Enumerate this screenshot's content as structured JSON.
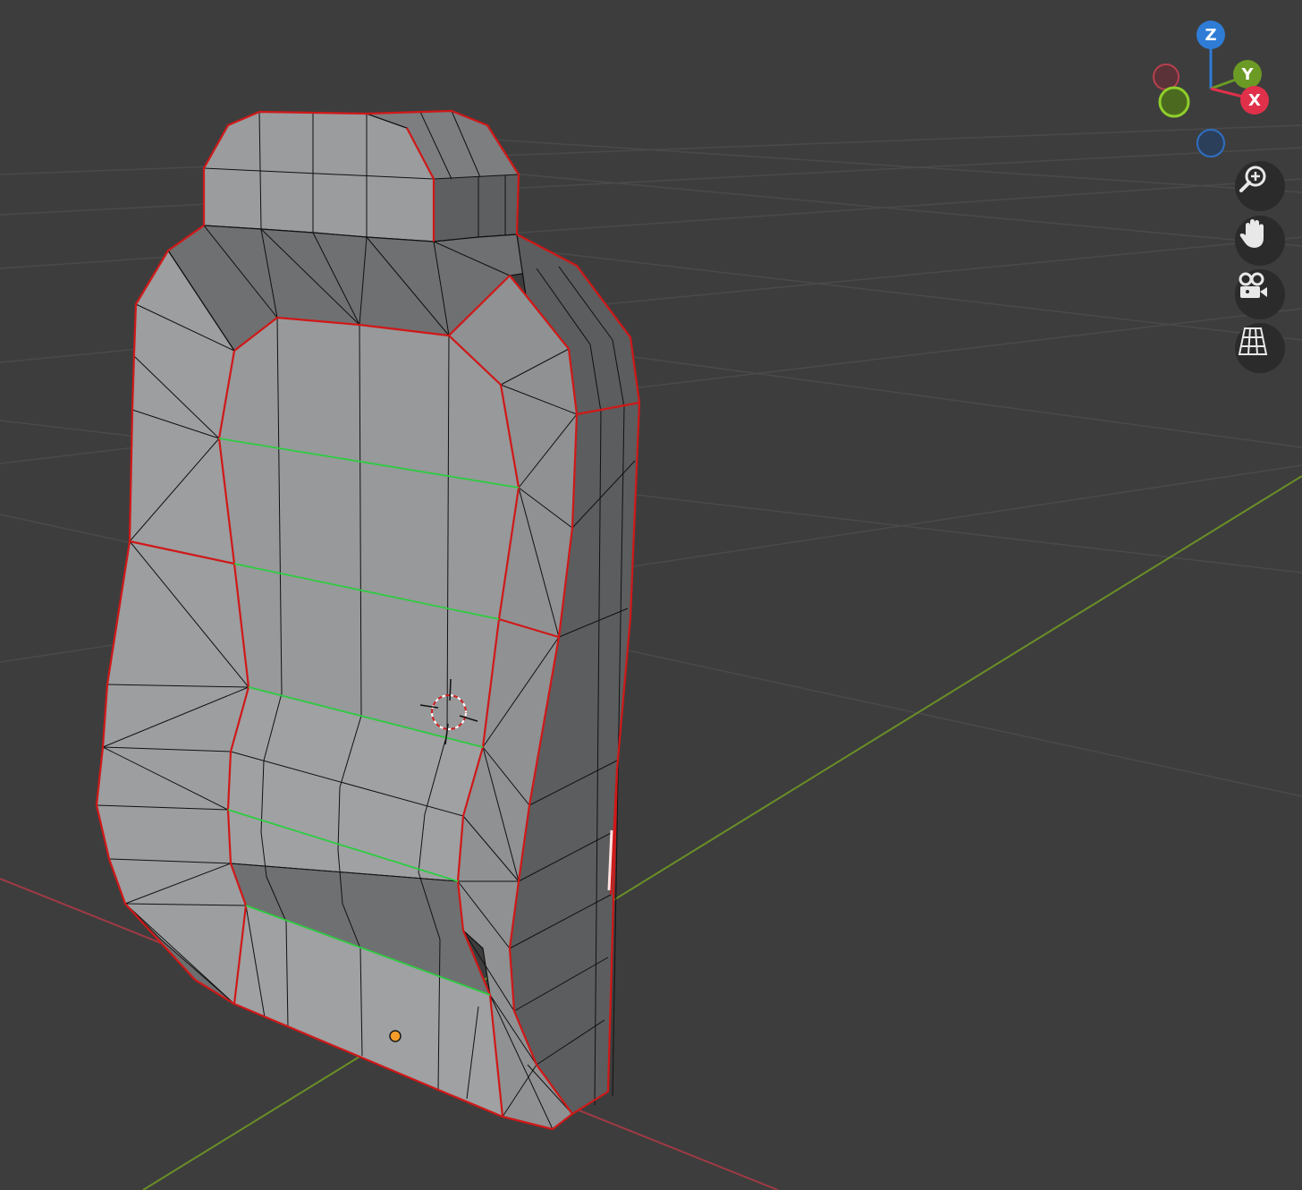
{
  "viewport": {
    "background": "#3d3d3d",
    "grid_color": "#4a4a4a",
    "x_axis_color": "#a03a45",
    "y_axis_color": "#6a8f27"
  },
  "mesh": {
    "face_light": "#9a9c9e",
    "face_mid": "#8d8f91",
    "face_dark": "#6c6d6e",
    "face_side": "#5c5d5e",
    "wire_color": "#111111",
    "seam_color": "#d01818",
    "sharp_color": "#2ecc40",
    "origin_color": "#f39c2a"
  },
  "gizmo": {
    "z_label": "Z",
    "y_label": "Y",
    "x_label": "X",
    "z_color": "#2e7cd6",
    "y_color": "#6b9a25",
    "x_color": "#e0304a"
  },
  "nav": {
    "zoom": "zoom-icon",
    "pan": "hand-icon",
    "camera": "camera-icon",
    "ortho": "grid-icon"
  }
}
